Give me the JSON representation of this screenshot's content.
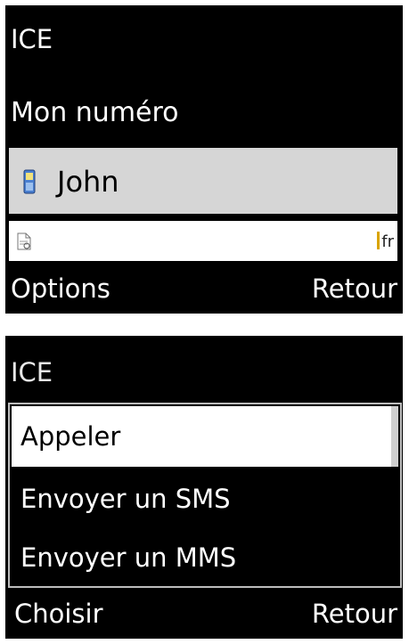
{
  "screen1": {
    "title": "ICE",
    "my_number": "Mon numéro",
    "contact": {
      "name": "John",
      "icon": "mobile-phone-icon"
    },
    "search": {
      "icon": "document-icon",
      "input_mode": "fr"
    },
    "softkeys": {
      "left": "Options",
      "right": "Retour"
    }
  },
  "screen2": {
    "title": "ICE",
    "menu": [
      {
        "label": "Appeler",
        "selected": true
      },
      {
        "label": "Envoyer un SMS",
        "selected": false
      },
      {
        "label": "Envoyer un MMS",
        "selected": false
      }
    ],
    "softkeys": {
      "left": "Choisir",
      "right": "Retour"
    }
  },
  "colors": {
    "background": "#000000",
    "selection_gray": "#d6d6d6",
    "selection_white": "#ffffff",
    "cursor": "#d9a400"
  }
}
